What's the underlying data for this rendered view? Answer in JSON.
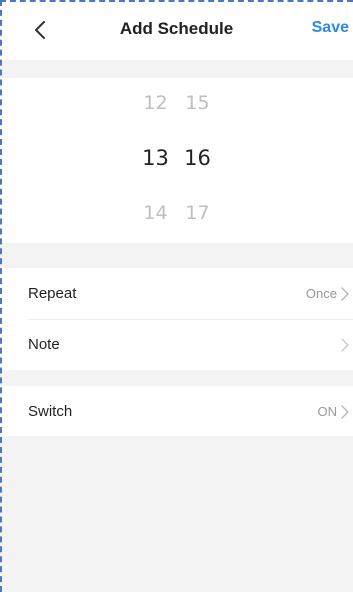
{
  "header": {
    "title": "Add Schedule",
    "save_label": "Save"
  },
  "picker": {
    "hours": [
      "12",
      "13",
      "14"
    ],
    "minutes": [
      "15",
      "16",
      "17"
    ],
    "selected_hour": "13",
    "selected_minute": "16"
  },
  "settings": {
    "repeat": {
      "label": "Repeat",
      "value": "Once"
    },
    "note": {
      "label": "Note",
      "value": ""
    },
    "switch": {
      "label": "Switch",
      "value": "ON"
    }
  },
  "colors": {
    "accent": "#2c8ae8",
    "background": "#f3f3f3"
  }
}
